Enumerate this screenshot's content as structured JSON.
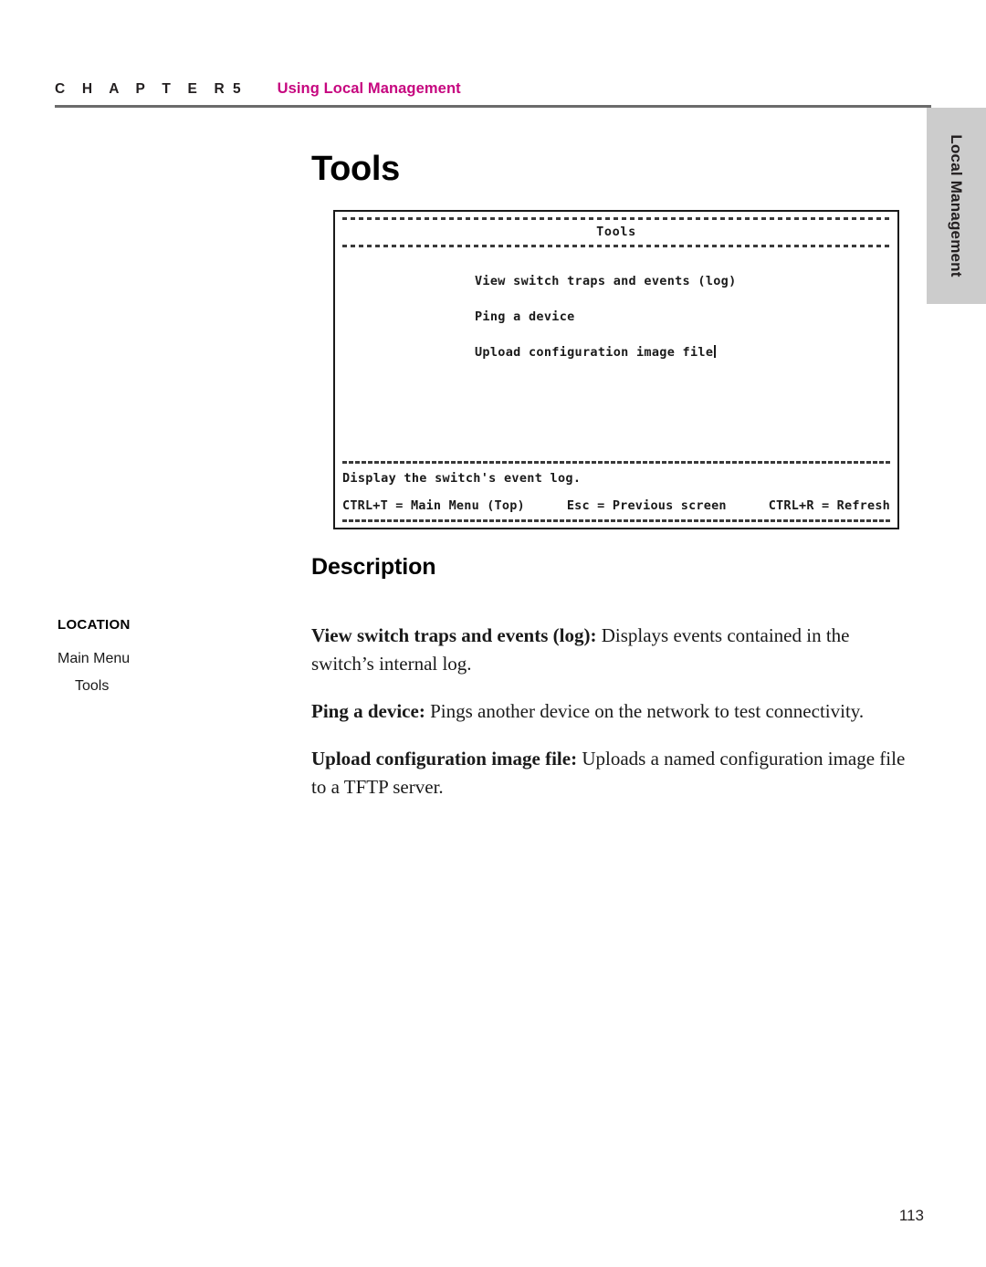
{
  "header": {
    "chapter_word": "C H A P T E R",
    "chapter_number": "5",
    "chapter_title": "Using Local Management"
  },
  "side_tab": {
    "label": "Local Management",
    "background": "#cccccc"
  },
  "page": {
    "title": "Tools",
    "number": "113",
    "accent_color": "#c6067f"
  },
  "terminal": {
    "screen_title": "Tools",
    "menu_items": [
      "View switch traps and events (log)",
      "Ping a device",
      "Upload configuration image file"
    ],
    "help_text": "Display the switch's event log.",
    "key_hints": [
      "CTRL+T = Main Menu (Top)",
      "Esc = Previous screen",
      "CTRL+R = Refresh"
    ]
  },
  "description": {
    "heading": "Description",
    "paragraphs": [
      {
        "lead": "View switch traps and events (log):",
        "text": " Displays events contained in the switch’s internal log."
      },
      {
        "lead": "Ping a device:",
        "text": " Pings another device on the network to test connectivity."
      },
      {
        "lead": "Upload configuration image file:",
        "text": " Uploads a named configuration image file to a TFTP server."
      }
    ]
  },
  "location": {
    "title": "LOCATION",
    "items": [
      "Main Menu",
      "Tools"
    ]
  }
}
